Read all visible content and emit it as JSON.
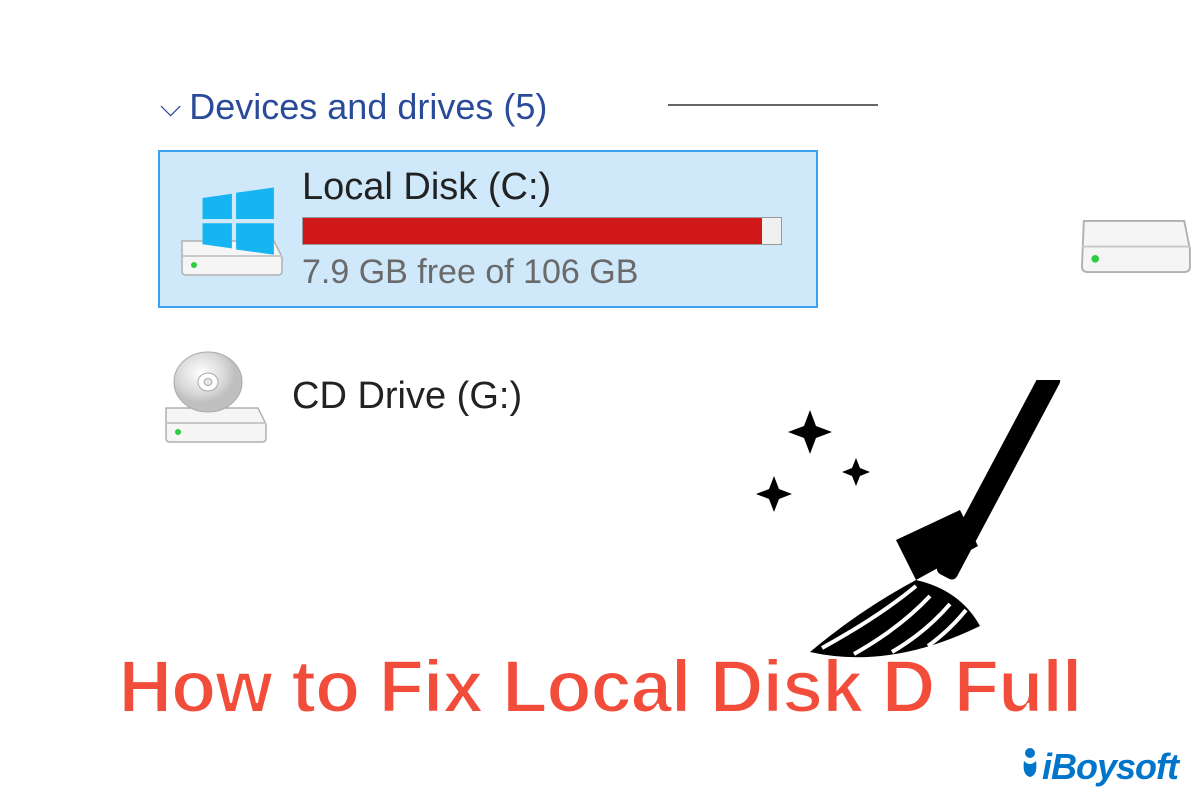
{
  "section": {
    "header": "Devices and drives (5)"
  },
  "drive_c": {
    "name": "Local Disk (C:)",
    "free_text": "7.9 GB free of 106 GB",
    "fill_percent": 96
  },
  "cd_drive": {
    "name": "CD Drive (G:)"
  },
  "headline": "How to Fix Local Disk D Full",
  "brand": "iBoysoft"
}
